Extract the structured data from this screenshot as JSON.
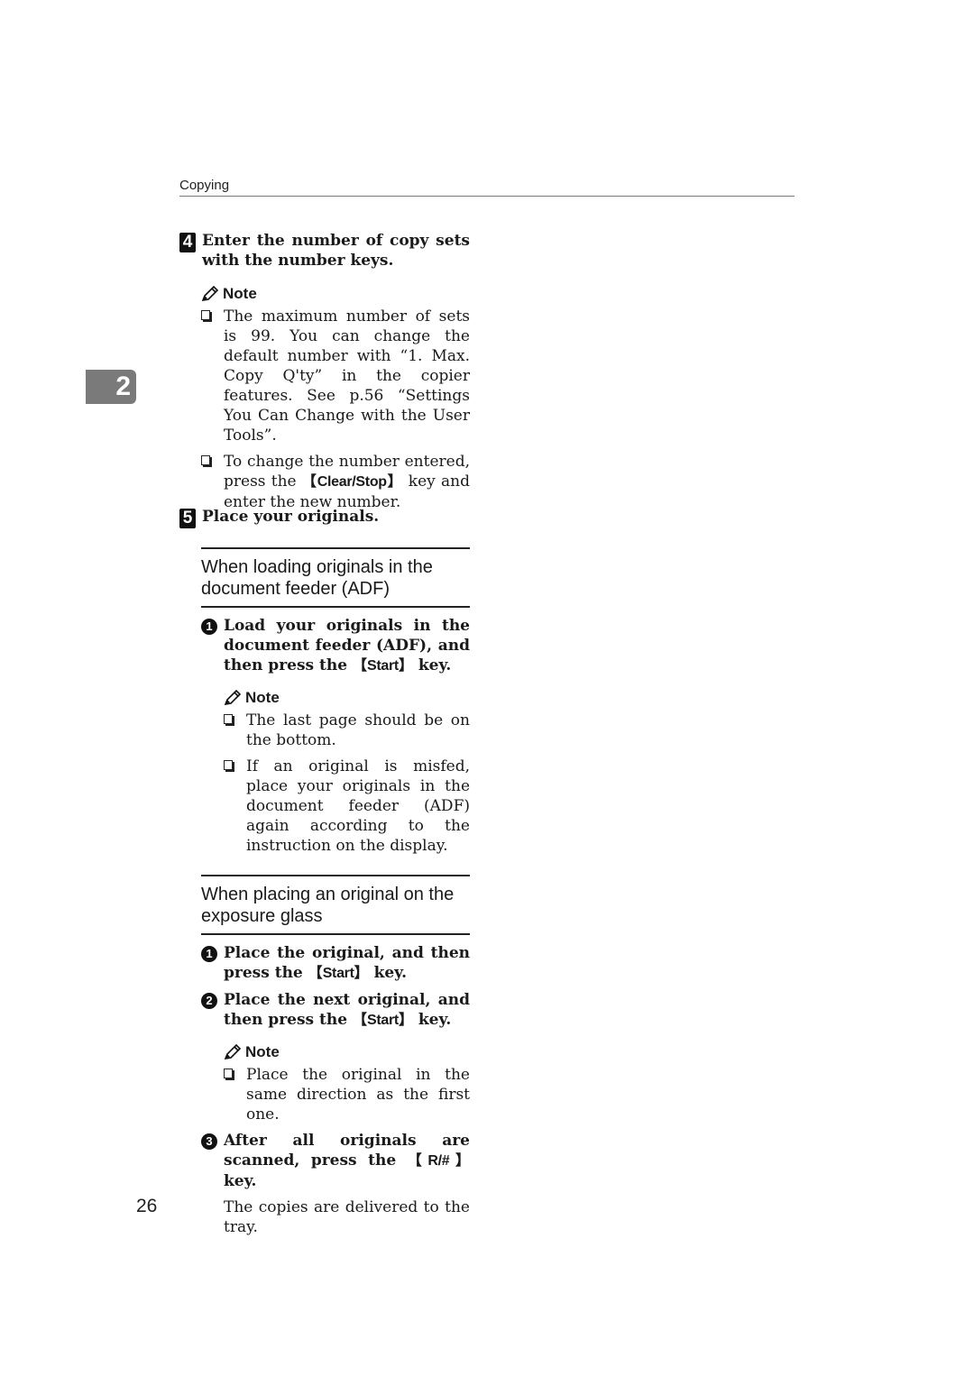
{
  "header": {
    "title": "Copying"
  },
  "chapter_tab": "2",
  "page_number": "26",
  "step4": {
    "number": "4",
    "text": "Enter the number of copy sets with the number keys.",
    "note_label": "Note",
    "notes": [
      "The maximum number of sets is 99. You can change the default number with “1. Max. Copy Q'ty” in the copier features. See p.56 “Settings You Can Change with the User Tools”.",
      {
        "before": "To change the number entered, press the ",
        "key": "Clear/Stop",
        "after": " key and enter the new number."
      }
    ]
  },
  "step5": {
    "number": "5",
    "text": "Place your originals."
  },
  "adf_section": {
    "heading": "When loading originals in the document feeder (ADF)",
    "substeps": [
      {
        "number": "1",
        "before": "Load your originals in the document feeder (ADF), and then press the ",
        "key": "Start",
        "after": " key."
      }
    ],
    "note_label": "Note",
    "notes": [
      "The last page should be on the bottom.",
      "If an original is misfed, place your originals in the document feeder (ADF) again according to the instruction on the display."
    ]
  },
  "glass_section": {
    "heading": "When placing an original on the exposure glass",
    "substeps": [
      {
        "number": "1",
        "before": "Place the original, and then press the ",
        "key": "Start",
        "after": " key."
      },
      {
        "number": "2",
        "before": "Place the next original, and then press the ",
        "key": "Start",
        "after": " key."
      },
      {
        "number": "3",
        "before": "After all originals are scanned, press the ",
        "key": "R/#",
        "after": " key."
      }
    ],
    "note_label": "Note",
    "notes": [
      "Place the original in the same direction as the first one."
    ],
    "result": "The copies are delivered to the tray."
  },
  "key_brackets": {
    "open": "【",
    "close": "】"
  }
}
